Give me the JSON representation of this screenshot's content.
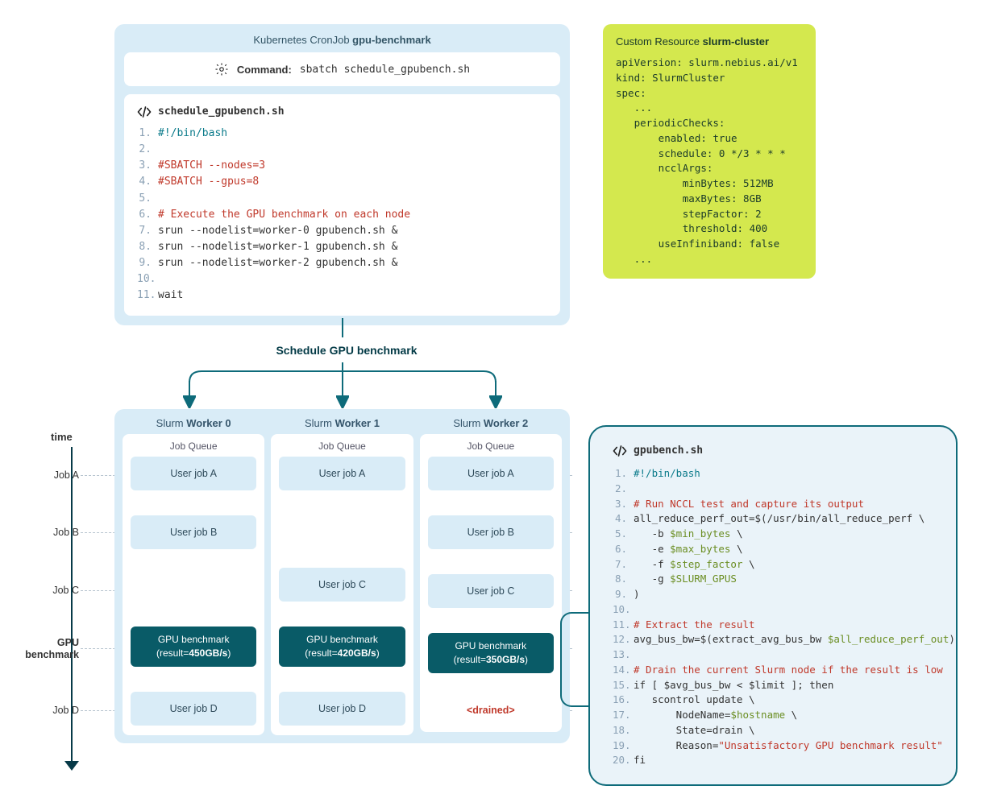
{
  "cronjob": {
    "title_prefix": "Kubernetes CronJob ",
    "title_name": "gpu-benchmark",
    "command_label": "Command:",
    "command_value": "sbatch schedule_gpubench.sh",
    "script_name": "schedule_gpubench.sh",
    "lines": {
      "l1": "#!/bin/bash",
      "l3": "#SBATCH --nodes=3",
      "l4": "#SBATCH --gpus=8",
      "l6": "# Execute the GPU benchmark on each node",
      "l7": "srun --nodelist=worker-0 gpubench.sh &",
      "l8": "srun --nodelist=worker-1 gpubench.sh &",
      "l9": "srun --nodelist=worker-2 gpubench.sh &",
      "l11": "wait"
    }
  },
  "cr": {
    "title_prefix": "Custom Resource ",
    "title_name": "slurm-cluster",
    "yaml": "apiVersion: slurm.nebius.ai/v1\nkind: SlurmCluster\nspec:\n   ...\n   periodicChecks:\n       enabled: true\n       schedule: 0 */3 * * *\n       ncclArgs:\n           minBytes: 512MB\n           maxBytes: 8GB\n           stepFactor: 2\n           threshold: 400\n       useInfiniband: false\n   ..."
  },
  "schedule_label": "Schedule GPU benchmark",
  "time_label": "time",
  "row_labels": {
    "a": "Job A",
    "b": "Job B",
    "c": "Job C",
    "g": "GPU\nbenchmark",
    "d": "Job D"
  },
  "workers": [
    {
      "title_prefix": "Slurm ",
      "title_name": "Worker 0",
      "queue_label": "Job Queue",
      "rows": {
        "a": "User job A",
        "b": "User job B",
        "c": null,
        "bench": {
          "name": "GPU benchmark",
          "result": "450GB/s"
        },
        "d": "User job D"
      }
    },
    {
      "title_prefix": "Slurm ",
      "title_name": "Worker 1",
      "queue_label": "Job Queue",
      "rows": {
        "a": "User job A",
        "b": null,
        "c": "User job C",
        "bench": {
          "name": "GPU benchmark",
          "result": "420GB/s"
        },
        "d": "User job D"
      }
    },
    {
      "title_prefix": "Slurm ",
      "title_name": "Worker 2",
      "queue_label": "Job Queue",
      "rows": {
        "a": "User job A",
        "b": "User job B",
        "c": "User job C",
        "bench": {
          "name": "GPU benchmark",
          "result": "350GB/s"
        },
        "d": "<drained>"
      }
    }
  ],
  "gpubench": {
    "script_name": "gpubench.sh",
    "lines": {
      "l1": "#!/bin/bash",
      "l3": "# Run NCCL test and capture its output",
      "l4a": "all_reduce_perf_out=$(/usr/bin/all_reduce_perf \\",
      "l5a": "   -b ",
      "l5v": "$min_bytes",
      "l5b": " \\",
      "l6a": "   -e ",
      "l6v": "$max_bytes",
      "l6b": " \\",
      "l7a": "   -f ",
      "l7v": "$step_factor",
      "l7b": " \\",
      "l8a": "   -g ",
      "l8v": "$SLURM_GPUS",
      "l9": ")",
      "l11": "# Extract the result",
      "l12a": "avg_bus_bw=$(extract_avg_bus_bw ",
      "l12v": "$all_reduce_perf_out",
      "l12b": ")",
      "l14": "# Drain the current Slurm node if the result is low",
      "l15": "if [ $avg_bus_bw < $limit ]; then",
      "l16": "   scontrol update \\",
      "l17a": "       NodeName=",
      "l17v": "$hostname",
      "l17b": " \\",
      "l18": "       State=drain \\",
      "l19a": "       Reason=",
      "l19v": "\"Unsatisfactory GPU benchmark result\"",
      "l20": "fi"
    }
  }
}
